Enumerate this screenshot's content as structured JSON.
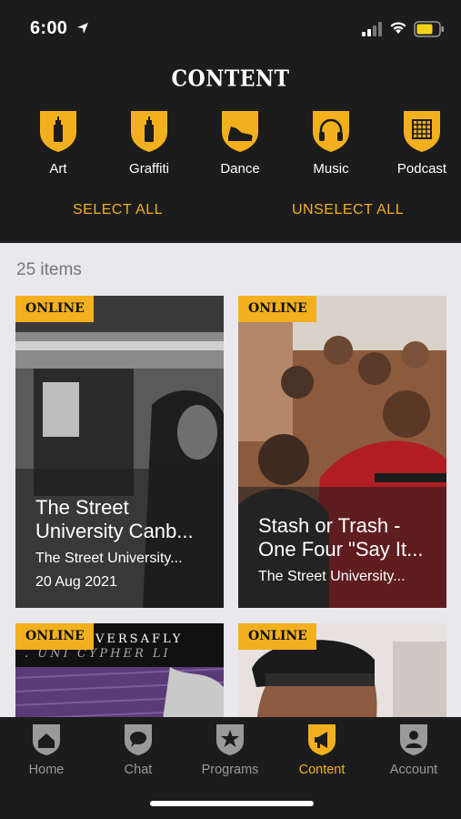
{
  "status": {
    "time": "6:00"
  },
  "header": {
    "title": "CONTENT",
    "categories": [
      {
        "label": "Art",
        "icon": "spray-can-icon"
      },
      {
        "label": "Graffiti",
        "icon": "spray-can-icon"
      },
      {
        "label": "Dance",
        "icon": "sneaker-icon"
      },
      {
        "label": "Music",
        "icon": "headphones-icon"
      },
      {
        "label": "Podcast",
        "icon": "grid-icon"
      }
    ],
    "select_all": "SELECT ALL",
    "unselect_all": "UNSELECT ALL"
  },
  "list": {
    "count": "25 items",
    "cards": [
      {
        "badge": "ONLINE",
        "title": "The Street University Canb...",
        "subtitle": "The Street University...",
        "date": "20 Aug 2021"
      },
      {
        "badge": "ONLINE",
        "title": "Stash or Trash - One Four \"Say It...",
        "subtitle": "The Street University...",
        "date": ""
      },
      {
        "badge": "ONLINE",
        "title": "",
        "subtitle": "",
        "date": "",
        "banner_text": "VERSAFLY",
        "banner_sub": ". UNI CYPHER LI"
      },
      {
        "badge": "ONLINE",
        "title": "",
        "subtitle": "",
        "date": ""
      }
    ]
  },
  "tabs": [
    {
      "label": "Home",
      "icon": "home-shield-icon"
    },
    {
      "label": "Chat",
      "icon": "chat-shield-icon"
    },
    {
      "label": "Programs",
      "icon": "star-shield-icon"
    },
    {
      "label": "Content",
      "icon": "megaphone-shield-icon",
      "active": true
    },
    {
      "label": "Account",
      "icon": "person-shield-icon"
    }
  ],
  "colors": {
    "accent": "#f2b01e",
    "background": "#1c1c1c",
    "list_bg": "#e8e8ed"
  }
}
